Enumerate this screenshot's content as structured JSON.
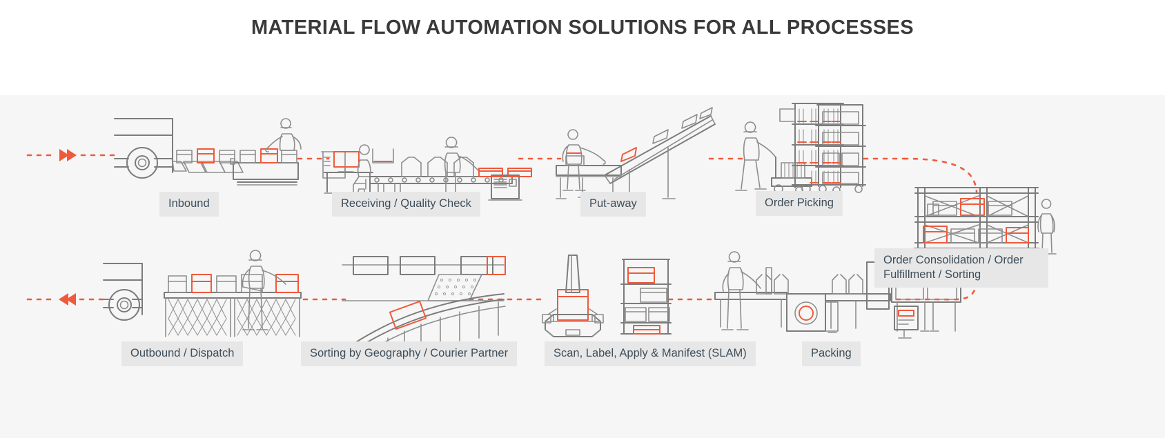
{
  "header": {
    "title": "MATERIAL FLOW AUTOMATION SOLUTIONS FOR ALL PROCESSES"
  },
  "colors": {
    "accent": "#ef5a3c",
    "line": "#7c7c7c",
    "line_light": "#9a9a9a",
    "label_bg": "#e7e7e7",
    "label_text": "#3f4e5a",
    "panel_bg": "#f6f6f6",
    "title_text": "#3a3a3c",
    "page_bg": "#ffffff"
  },
  "diagram": {
    "type": "process-flow",
    "flow_note": "Top row flows left-to-right, curves down at right, bottom row flows right-to-left",
    "top_row": [
      {
        "id": "inbound",
        "label": "Inbound",
        "icon": "truck-unloading-conveyor-icon"
      },
      {
        "id": "receiving",
        "label": "Receiving / Quality Check",
        "icon": "workstation-conveyor-boxes-icon"
      },
      {
        "id": "putaway",
        "label": "Put-away",
        "icon": "incline-conveyor-icon"
      },
      {
        "id": "picking",
        "label": "Order Picking",
        "icon": "worker-pallet-jack-racks-icon"
      }
    ],
    "right_node": {
      "id": "consolidation",
      "label": "Order Consolidation / Order Fulfillment / Sorting",
      "icon": "pallet-rack-worker-icon"
    },
    "bottom_row": [
      {
        "id": "outbound",
        "label": "Outbound / Dispatch",
        "icon": "truck-loading-scissor-conveyor-icon"
      },
      {
        "id": "sorting",
        "label": "Sorting by Geography / Courier Partner",
        "icon": "sorter-chute-icon"
      },
      {
        "id": "slam",
        "label": "Scan, Label, Apply & Manifest (SLAM)",
        "icon": "labeler-shelving-icon"
      },
      {
        "id": "packing",
        "label": "Packing",
        "icon": "packing-line-worker-icon"
      }
    ],
    "markers": [
      {
        "id": "flow-start",
        "icon": "double-chevron-right-icon",
        "direction": "right"
      },
      {
        "id": "flow-end",
        "icon": "double-chevron-left-icon",
        "direction": "left"
      }
    ]
  }
}
